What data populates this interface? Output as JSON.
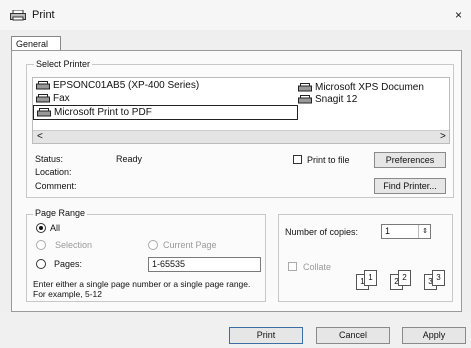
{
  "window": {
    "title": "Print",
    "close_glyph": "×"
  },
  "tabs": [
    {
      "label": "General"
    }
  ],
  "select_printer": {
    "label": "Select Printer",
    "printers": [
      {
        "name": "EPSONC01AB5 (XP-400 Series)",
        "icon": "printer-icon"
      },
      {
        "name": "Fax",
        "icon": "printer-icon"
      },
      {
        "name": "Microsoft Print to PDF",
        "icon": "printer-icon",
        "selected": true
      },
      {
        "name": "Microsoft XPS Documen",
        "icon": "printer-icon"
      },
      {
        "name": "Snagit 12",
        "icon": "printer-icon"
      }
    ],
    "scroll_left": "<",
    "scroll_right": ">",
    "status_label": "Status:",
    "status_value": "Ready",
    "location_label": "Location:",
    "comment_label": "Comment:",
    "print_to_file_label": "Print to file",
    "preferences_label": "Preferences",
    "find_printer_label": "Find Printer..."
  },
  "page_range": {
    "label": "Page Range",
    "all_label": "All",
    "selection_label": "Selection",
    "current_page_label": "Current Page",
    "pages_label": "Pages:",
    "pages_value": "1-65535",
    "hint": "Enter either a single page number or a single page range.  For example, 5-12",
    "selected_option": "All"
  },
  "copies": {
    "number_label": "Number of copies:",
    "number_value": "1",
    "collate_label": "Collate",
    "collate_checked": false,
    "collate_icons": [
      "1",
      "1",
      "2",
      "2",
      "3",
      "3"
    ]
  },
  "buttons": {
    "print": "Print",
    "cancel": "Cancel",
    "apply": "Apply"
  }
}
